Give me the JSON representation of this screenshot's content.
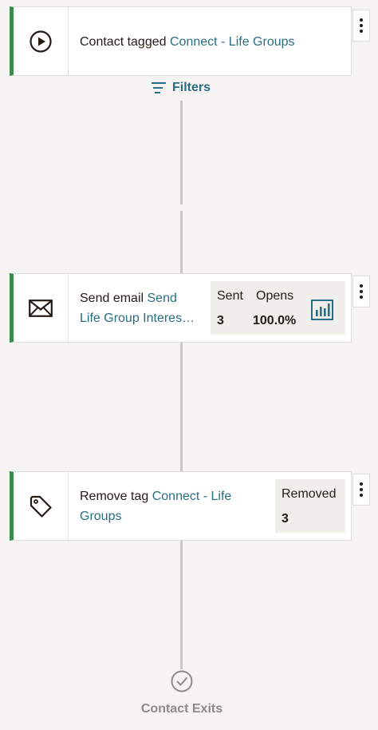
{
  "trigger": {
    "prefix": "Contact tagged",
    "tag": "Connect - Life Groups"
  },
  "filters": {
    "label": "Filters"
  },
  "send_email": {
    "prefix": "Send email",
    "name_line1": "Send",
    "name_line2": "Life Group Interes…",
    "stats": {
      "sent_label": "Sent",
      "sent_value": "3",
      "opens_label": "Opens",
      "opens_value": "100.0%"
    }
  },
  "remove_tag": {
    "prefix": "Remove tag",
    "tag_line1": "Connect - Life",
    "tag_line2": "Groups",
    "stats": {
      "removed_label": "Removed",
      "removed_value": "3"
    }
  },
  "exit": {
    "label": "Contact Exits"
  },
  "colors": {
    "accent_green": "#3a8a4b",
    "link_teal": "#2a6e82",
    "background": "#f5f4f2",
    "stats_bg": "#efeeea"
  },
  "icons": {
    "trigger": "play-circle-icon",
    "filters": "filter-lines-icon",
    "send_email": "envelope-icon",
    "report": "bar-chart-icon",
    "remove_tag": "tag-icon",
    "exit": "check-circle-icon",
    "menu": "kebab-menu-icon"
  }
}
